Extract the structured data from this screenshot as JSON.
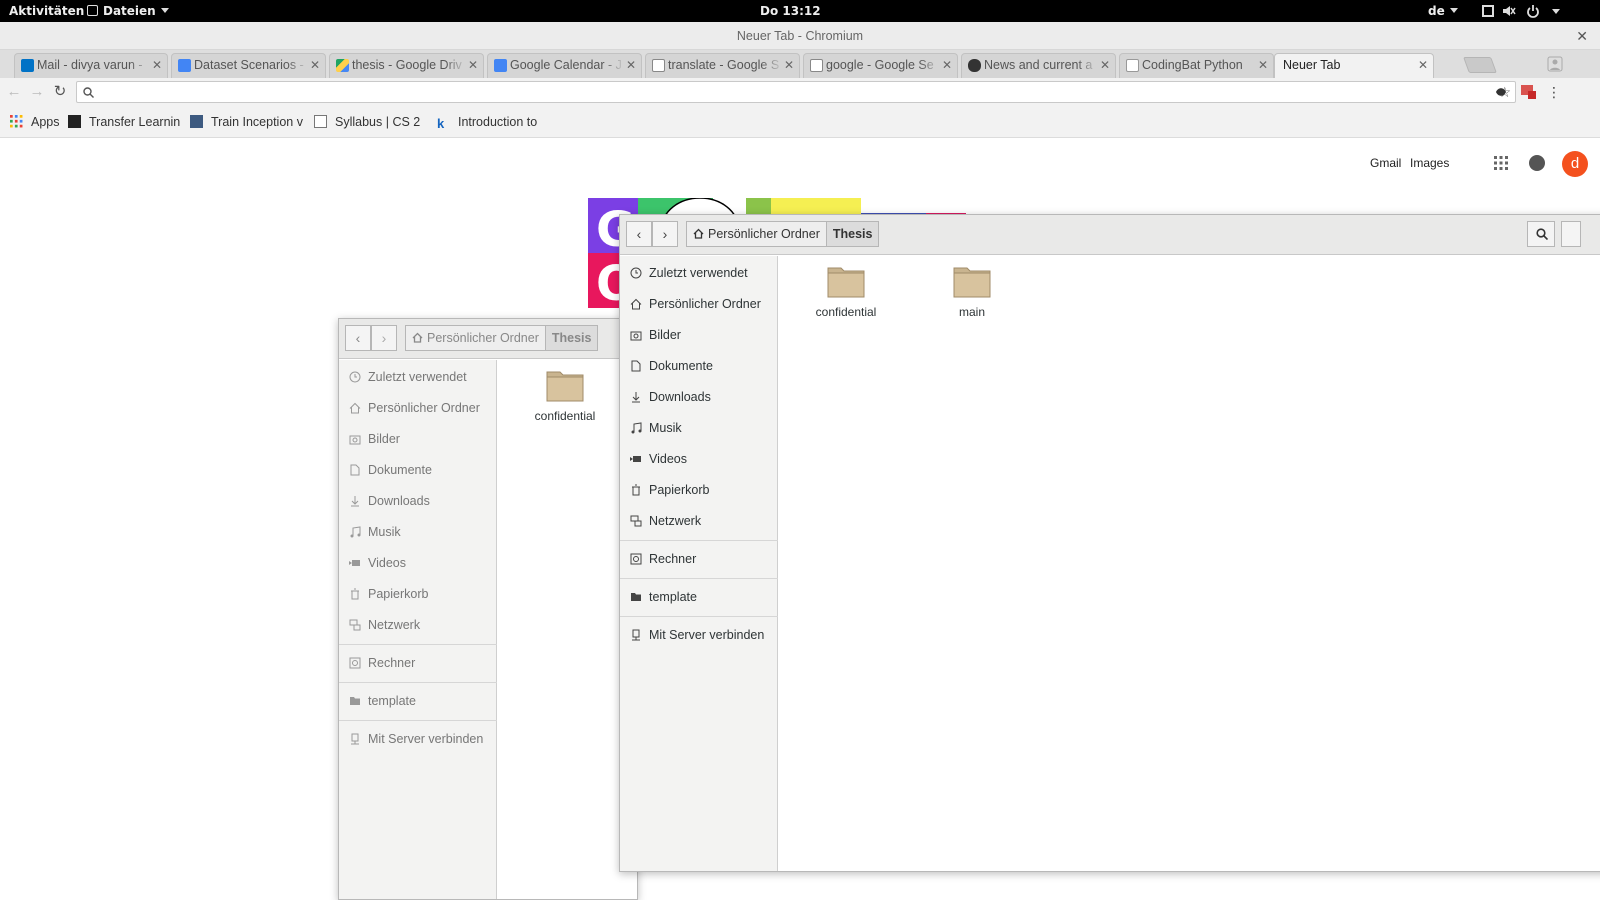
{
  "topbar": {
    "activities": "Aktivitäten",
    "app_menu": "Dateien",
    "clock": "Do 13:12",
    "language": "de"
  },
  "browser": {
    "window_title": "Neuer Tab - Chromium",
    "tabs": [
      {
        "label": "Mail - divya varun -",
        "favicon": "outlook-icon",
        "color": "#0072c6"
      },
      {
        "label": "Dataset Scenarios -",
        "favicon": "docs-icon",
        "color": "#4285f4"
      },
      {
        "label": "thesis - Google Driv",
        "favicon": "drive-icon",
        "color": "#1fa463"
      },
      {
        "label": "Google Calendar - J",
        "favicon": "calendar-icon",
        "color": "#4285f4"
      },
      {
        "label": "translate - Google S",
        "favicon": "google-icon",
        "color": "#888888"
      },
      {
        "label": "google - Google Se",
        "favicon": "google-icon",
        "color": "#888888"
      },
      {
        "label": "News and current a",
        "favicon": "news-icon",
        "color": "#333333"
      },
      {
        "label": "CodingBat Python",
        "favicon": "page-icon",
        "color": "#999999"
      },
      {
        "label": "Neuer Tab",
        "favicon": "",
        "color": ""
      }
    ],
    "omnibox_value": "",
    "bookmarks": [
      {
        "label": "Apps",
        "icon": "apps-grid-icon"
      },
      {
        "label": "Transfer Learnin",
        "icon": "bookmark-icon"
      },
      {
        "label": "Train Inception v",
        "icon": "bookmark-icon"
      },
      {
        "label": "Syllabus | CS 2",
        "icon": "page-icon"
      },
      {
        "label": "Introduction to",
        "icon": "k-icon"
      }
    ]
  },
  "google_page": {
    "gmail": "Gmail",
    "images": "Images",
    "avatar_letter": "d",
    "avatar_color": "#f4511e"
  },
  "file_manager": {
    "path_home": "Persönlicher Ordner",
    "path_current": "Thesis",
    "sidebar": [
      {
        "label": "Zuletzt verwendet",
        "icon": "clock-icon"
      },
      {
        "label": "Persönlicher Ordner",
        "icon": "home-icon"
      },
      {
        "label": "Bilder",
        "icon": "camera-icon"
      },
      {
        "label": "Dokumente",
        "icon": "document-icon"
      },
      {
        "label": "Downloads",
        "icon": "download-icon"
      },
      {
        "label": "Musik",
        "icon": "music-icon"
      },
      {
        "label": "Videos",
        "icon": "video-icon"
      },
      {
        "label": "Papierkorb",
        "icon": "trash-icon"
      },
      {
        "label": "Netzwerk",
        "icon": "network-icon"
      },
      {
        "label": "Rechner",
        "icon": "computer-icon"
      },
      {
        "label": "template",
        "icon": "folder-icon"
      },
      {
        "label": "Mit Server verbinden",
        "icon": "server-icon"
      }
    ],
    "front_files": [
      "confidential",
      "main"
    ],
    "back_files": [
      "confidential"
    ]
  }
}
